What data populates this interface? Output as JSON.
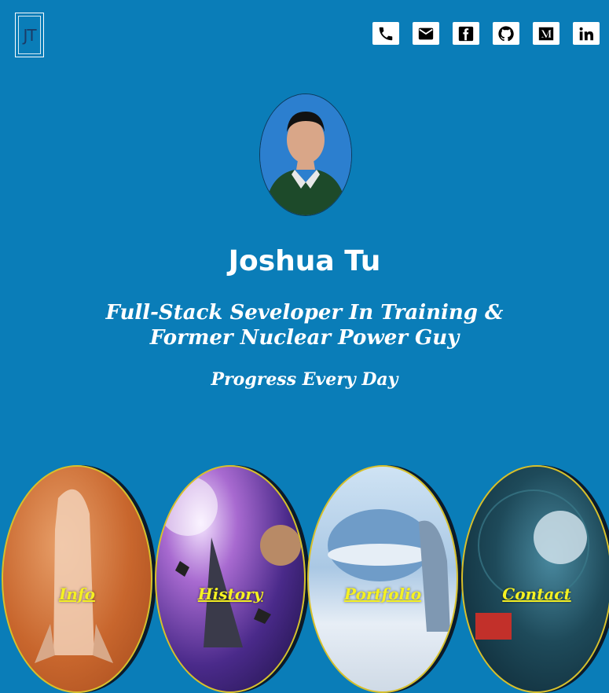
{
  "logo": {
    "text": "JT"
  },
  "social": [
    {
      "name": "phone-icon"
    },
    {
      "name": "email-icon"
    },
    {
      "name": "facebook-icon"
    },
    {
      "name": "github-icon"
    },
    {
      "name": "medium-icon"
    },
    {
      "name": "linkedin-icon"
    }
  ],
  "profile": {
    "name": "Joshua Tu",
    "tagline_line1": "Full-Stack Seveloper In Training &",
    "tagline_line2": "Former Nuclear Power Guy",
    "motto": "Progress Every Day"
  },
  "nav": {
    "info": "Info",
    "history": "History",
    "portfolio": "Portfolio",
    "contact": "Contact"
  },
  "colors": {
    "background": "#0a7db8",
    "nav_label": "#f5f122",
    "oval_border": "#d8c02a"
  }
}
